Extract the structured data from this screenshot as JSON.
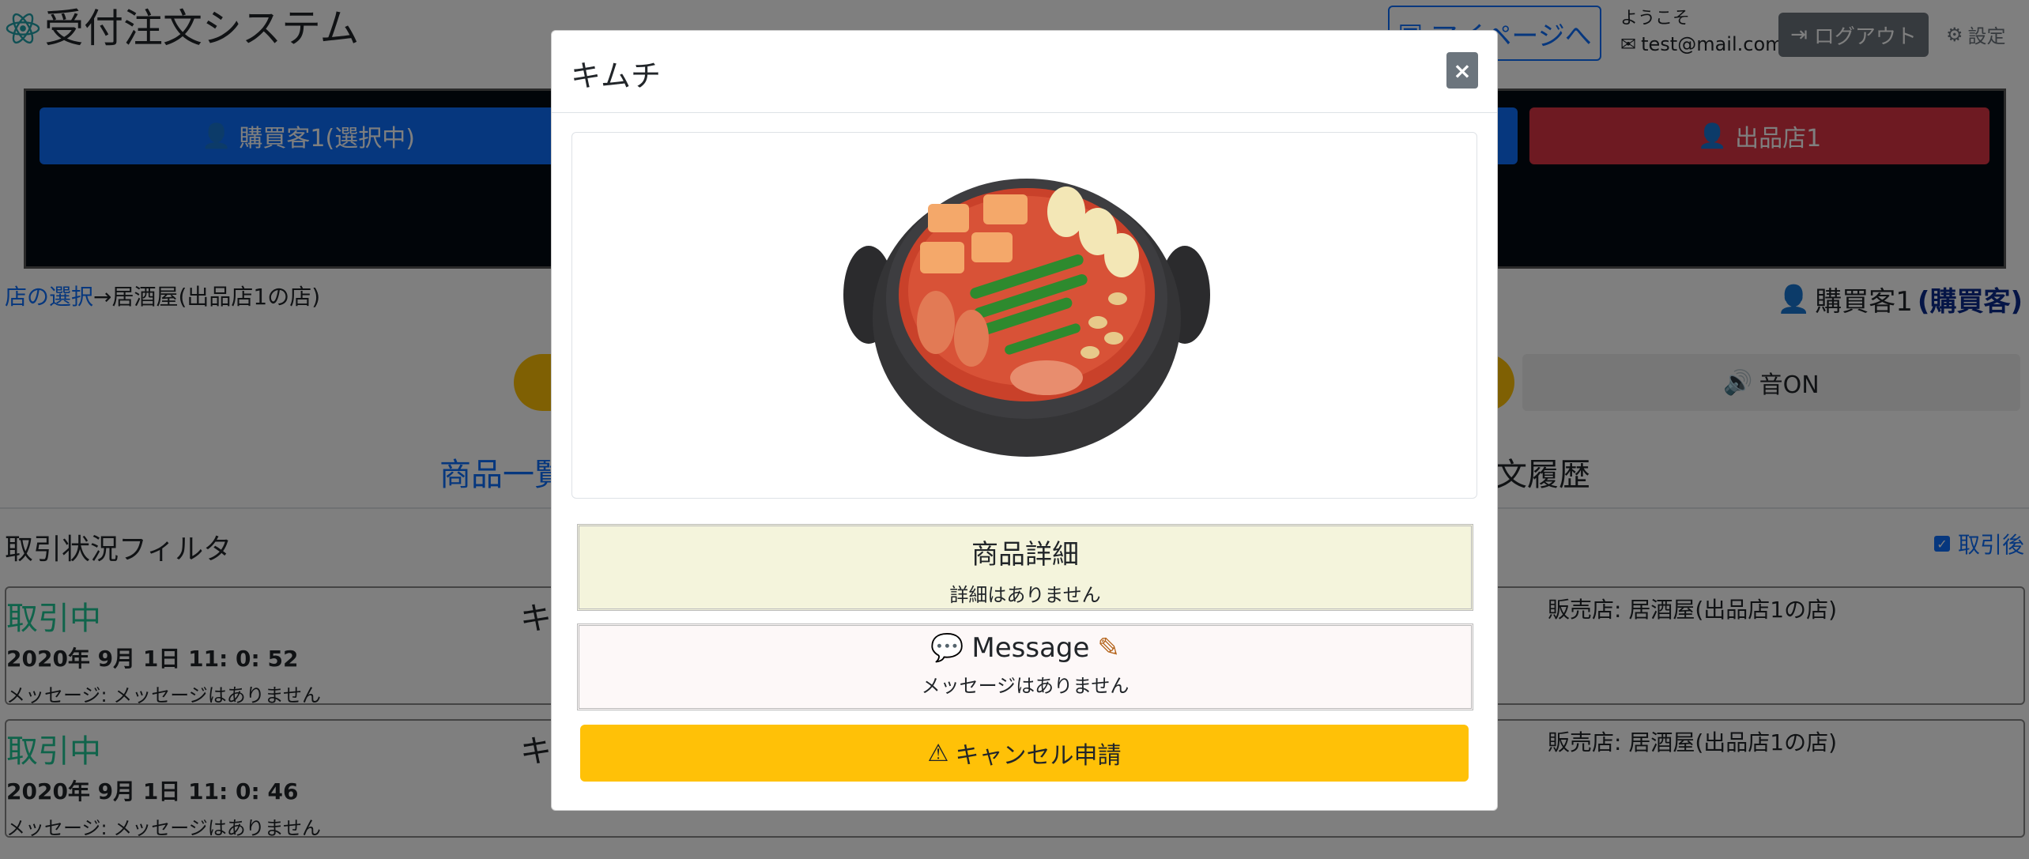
{
  "app": {
    "title": "受付注文システム",
    "mypage_label": "マイページへ",
    "welcome_label": "ようこそ",
    "user_email": "test@mail.com",
    "logout_label": "ログアウト",
    "settings_label": "設定"
  },
  "users": {
    "buyer_label": "購買客1(選択中)",
    "seller_label": "出品店1"
  },
  "breadcrumb": {
    "link_label": "店の選択",
    "arrow": "→",
    "current_label": "居酒屋(出品店1の店)"
  },
  "current_user": {
    "name": "購買客1",
    "role": "(購買客)"
  },
  "sound_label": "音ON",
  "tabs": {
    "left_label": "商品一覧",
    "right_label": "文履歴"
  },
  "filter": {
    "title": "取引状況フィルタ",
    "check_label": "取引後"
  },
  "orders": [
    {
      "status": "取引中",
      "date": "2020年 9月 1日 11: 0: 52",
      "message": "メッセージ: メッセージはありません",
      "item_fragment": "キ",
      "seller": "販売店: 居酒屋(出品店1の店)"
    },
    {
      "status": "取引中",
      "date": "2020年 9月 1日 11: 0: 46",
      "message": "メッセージ: メッセージはありません",
      "item_fragment": "キ",
      "seller": "販売店: 居酒屋(出品店1の店)"
    }
  ],
  "modal": {
    "title": "キムチ",
    "close_symbol": "×",
    "detail_title": "商品詳細",
    "detail_body": "詳細はありません",
    "message_title": "Message",
    "message_body": "メッセージはありません",
    "cancel_label": "キャンセル申請"
  },
  "colors": {
    "primary": "#0d6efd",
    "danger": "#dc3545",
    "warning": "#ffc107",
    "secondary": "#6c757d",
    "status_green": "#20c997"
  },
  "icons": [
    "atom-icon",
    "user-icon",
    "envelope-icon",
    "logout-icon",
    "gear-icon",
    "volume-icon",
    "close-icon",
    "comment-icon",
    "pencil-icon",
    "warning-icon"
  ]
}
